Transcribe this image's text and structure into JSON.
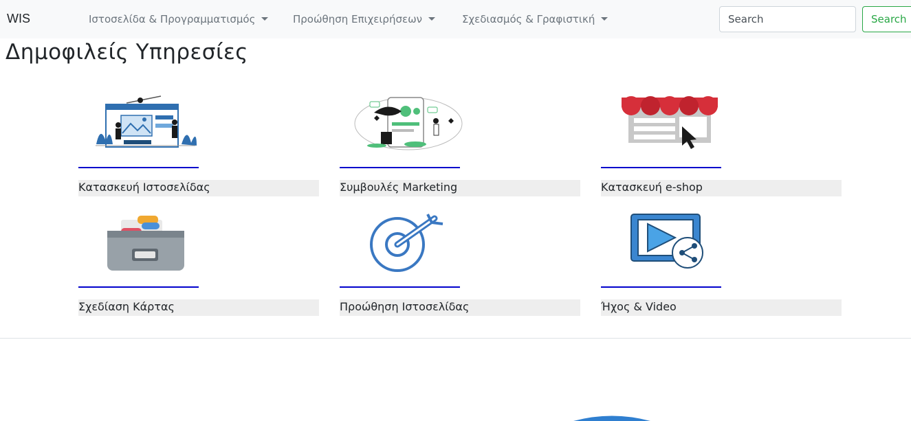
{
  "navbar": {
    "brand": "WIS",
    "menus": [
      {
        "label": "Ιστοσελίδα & Προγραμματισμός"
      },
      {
        "label": "Προώθηση Επιχειρήσεων"
      },
      {
        "label": "Σχεδιασμός & Γραφιστική"
      }
    ],
    "search": {
      "placeholder": "Search",
      "button_label": "Search"
    }
  },
  "main": {
    "title": "Δημοφιλείς Υπηρεσίες",
    "services": [
      {
        "label": "Κατασκευή Ιστοσελίδας",
        "icon": "web-design-illustration-icon"
      },
      {
        "label": "Συμβουλές Marketing",
        "icon": "marketing-illustration-icon"
      },
      {
        "label": "Κατασκευή e-shop",
        "icon": "eshop-storefront-icon"
      },
      {
        "label": "Σχεδίαση Κάρτας",
        "icon": "card-file-box-icon"
      },
      {
        "label": "Προώθηση Ιστοσελίδας",
        "icon": "target-icon"
      },
      {
        "label": "Ήχος & Video",
        "icon": "video-share-icon"
      }
    ]
  },
  "colors": {
    "navbar_bg": "#f8f9fa",
    "search_accent": "#28a745",
    "rule_color": "#0000cc",
    "caption_bg": "#eeeeee"
  }
}
